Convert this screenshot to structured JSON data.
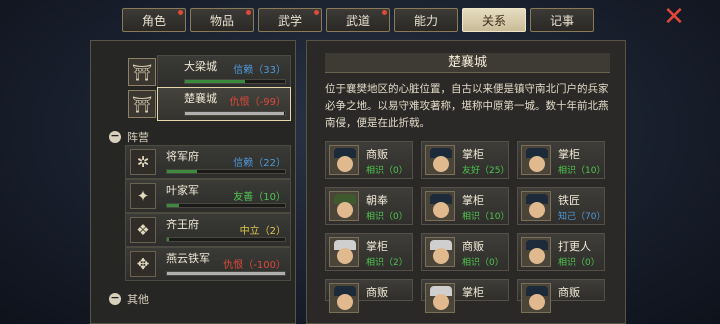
{
  "tabs": [
    {
      "label": "角色",
      "dot": true
    },
    {
      "label": "物品",
      "dot": true
    },
    {
      "label": "武学",
      "dot": true
    },
    {
      "label": "武道",
      "dot": true
    },
    {
      "label": "能力",
      "dot": false
    },
    {
      "label": "关系",
      "dot": false,
      "active": true
    },
    {
      "label": "记事",
      "dot": false
    }
  ],
  "cities": [
    {
      "name": "大梁城",
      "relation": "信赖（33）",
      "color": "#4f9ad8",
      "fill": 0.6,
      "bar": "#3c8a3c"
    },
    {
      "name": "楚襄城",
      "relation": "仇恨（-99）",
      "color": "#e0483a",
      "fill": 0.99,
      "bar": "#b0b0b0",
      "selected": true
    }
  ],
  "sections": {
    "factions": "阵营",
    "others": "其他"
  },
  "factions": [
    {
      "name": "将军府",
      "relation": "信赖（22）",
      "color": "#4f9ad8",
      "fill": 0.25,
      "bar": "#3c8a3c",
      "icon": "✲"
    },
    {
      "name": "叶家军",
      "relation": "友善（10）",
      "color": "#4fc44f",
      "fill": 0.1,
      "bar": "#3c8a3c",
      "icon": "✦"
    },
    {
      "name": "齐王府",
      "relation": "中立（2）",
      "color": "#e0c84a",
      "fill": 0.02,
      "bar": "#3c8a3c",
      "icon": "❖"
    },
    {
      "name": "燕云铁军",
      "relation": "仇恨（-100）",
      "color": "#e0483a",
      "fill": 1.0,
      "bar": "#b0b0b0",
      "icon": "✥"
    }
  ],
  "detail": {
    "title": "楚襄城",
    "description": "位于襄樊地区的心脏位置，自古以来便是镇守南北门户的兵家必争之地。以易守难攻著称，堪称中原第一城。数十年前北燕南侵，便是在此折戟。"
  },
  "npcs": [
    {
      "name": "商贩",
      "relation": "相识（0）",
      "color": "#4fc44f",
      "face": "blue"
    },
    {
      "name": "掌柜",
      "relation": "友好（25）",
      "color": "#4fc44f",
      "face": "blue"
    },
    {
      "name": "掌柜",
      "relation": "相识（10）",
      "color": "#4fc44f",
      "face": "blue"
    },
    {
      "name": "朝奉",
      "relation": "相识（0）",
      "color": "#4fc44f",
      "face": "green"
    },
    {
      "name": "掌柜",
      "relation": "相识（10）",
      "color": "#4fc44f",
      "face": "blue"
    },
    {
      "name": "铁匠",
      "relation": "知己（70）",
      "color": "#4f9ad8",
      "face": "blue"
    },
    {
      "name": "掌柜",
      "relation": "相识（2）",
      "color": "#4fc44f",
      "face": "grey"
    },
    {
      "name": "商贩",
      "relation": "相识（0）",
      "color": "#4fc44f",
      "face": "grey"
    },
    {
      "name": "打更人",
      "relation": "相识（0）",
      "color": "#4fc44f",
      "face": "blue"
    },
    {
      "name": "商贩",
      "relation": "",
      "color": "#4fc44f",
      "face": "blue"
    },
    {
      "name": "掌柜",
      "relation": "",
      "color": "#4fc44f",
      "face": "grey"
    },
    {
      "name": "商贩",
      "relation": "",
      "color": "#4fc44f",
      "face": "blue"
    }
  ],
  "icons": {
    "close": "close-icon"
  }
}
